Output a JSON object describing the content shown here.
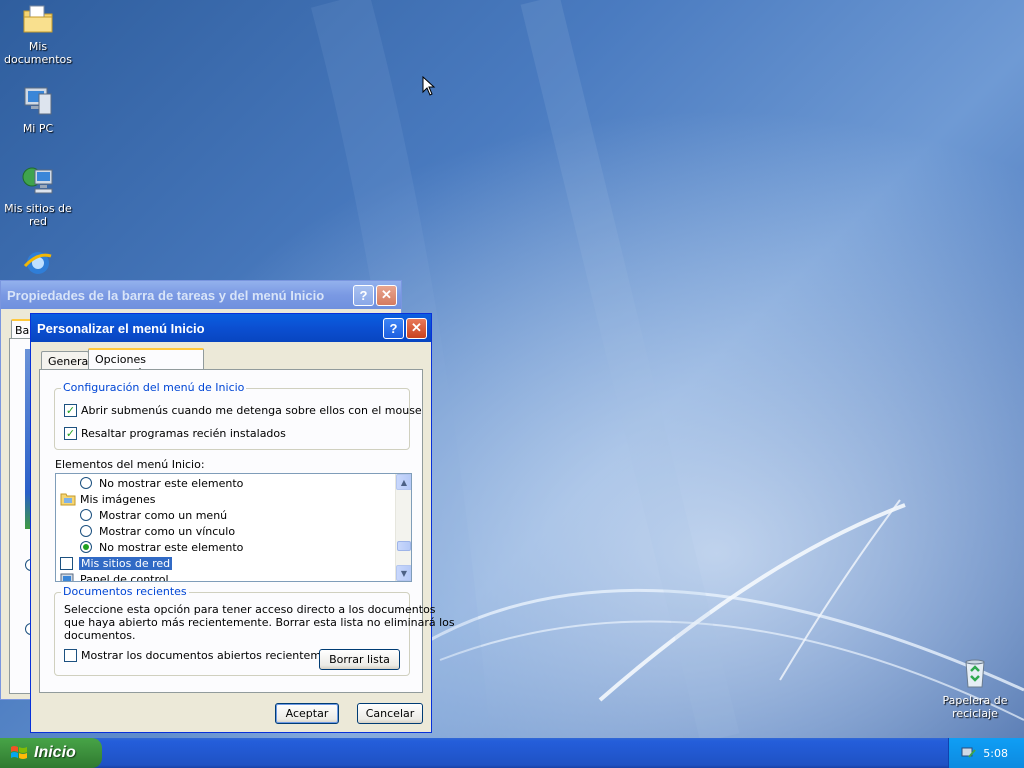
{
  "desktop": {
    "icons": [
      {
        "label": "Mis documentos",
        "icon": "folder-documents-icon"
      },
      {
        "label": "Mi PC",
        "icon": "computer-icon"
      },
      {
        "label": "Mis sitios de red",
        "icon": "network-icon"
      },
      {
        "label": "Papelera de reciclaje",
        "icon": "recycle-bin-icon"
      }
    ]
  },
  "bg_window": {
    "title": "Propiedades de la barra de tareas y del menú Inicio",
    "tab_partial": "Ba"
  },
  "dialog": {
    "title": "Personalizar el menú Inicio",
    "tabs": [
      "General",
      "Opciones avanzadas"
    ],
    "group_config": {
      "legend": "Configuración del menú de Inicio",
      "options": [
        {
          "label": "Abrir submenús cuando me detenga sobre ellos con el mouse",
          "checked": true
        },
        {
          "label": "Resaltar programas recién instalados",
          "checked": true
        }
      ]
    },
    "elements_label": "Elementos del menú Inicio:",
    "list": {
      "r1": "No mostrar este elemento",
      "mis_imagenes": "Mis imágenes",
      "r2": "Mostrar como un menú",
      "r3": "Mostrar como un vínculo",
      "r4": "No mostrar este elemento",
      "mis_sitios": "Mis sitios de red",
      "panel": "Panel de control"
    },
    "group_docs": {
      "legend": "Documentos recientes",
      "desc_l1": "Seleccione esta opción para tener acceso directo a los documentos",
      "desc_l2": "que haya abierto más recientemente. Borrar esta lista no eliminará los",
      "desc_l3": "documentos.",
      "check_label": "Mostrar los documentos abiertos recientemente",
      "clear_button": "Borrar lista"
    },
    "ok": "Aceptar",
    "cancel": "Cancelar"
  },
  "taskbar": {
    "start": "Inicio",
    "clock": "5:08"
  },
  "colors": {
    "xp_blue": "#0a5fe0",
    "start_green": "#3c8f3c",
    "selection": "#316ac5"
  }
}
